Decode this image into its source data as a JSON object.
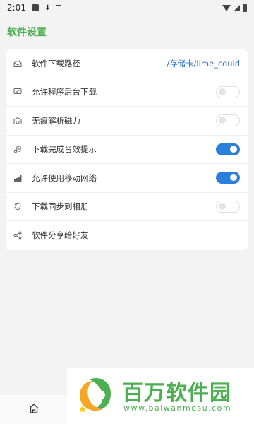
{
  "status_bar": {
    "time": "2:01"
  },
  "page": {
    "title": "软件设置"
  },
  "settings": [
    {
      "icon": "mailbox-icon",
      "label": "软件下载路径",
      "value": "/存储卡/lime_could"
    },
    {
      "icon": "monitor-icon",
      "label": "允许程序后台下载",
      "toggle": "off"
    },
    {
      "icon": "magnet-box-icon",
      "label": "无痕解析磁力",
      "toggle": "off"
    },
    {
      "icon": "music-note-icon",
      "label": "下载完成音效提示",
      "toggle": "on"
    },
    {
      "icon": "signal-bars-icon",
      "label": "允许使用移动网络",
      "toggle": "on"
    },
    {
      "icon": "sync-icon",
      "label": "下载同步到相册",
      "toggle": "off"
    },
    {
      "icon": "share-icon",
      "label": "软件分享给好友"
    }
  ],
  "promo": {
    "brand": "百万软件园",
    "url": "www.baiwanmosu.com"
  },
  "colors": {
    "accent": "#4caf50",
    "toggle_on": "#2b7fdc",
    "link": "#2f74d4"
  }
}
